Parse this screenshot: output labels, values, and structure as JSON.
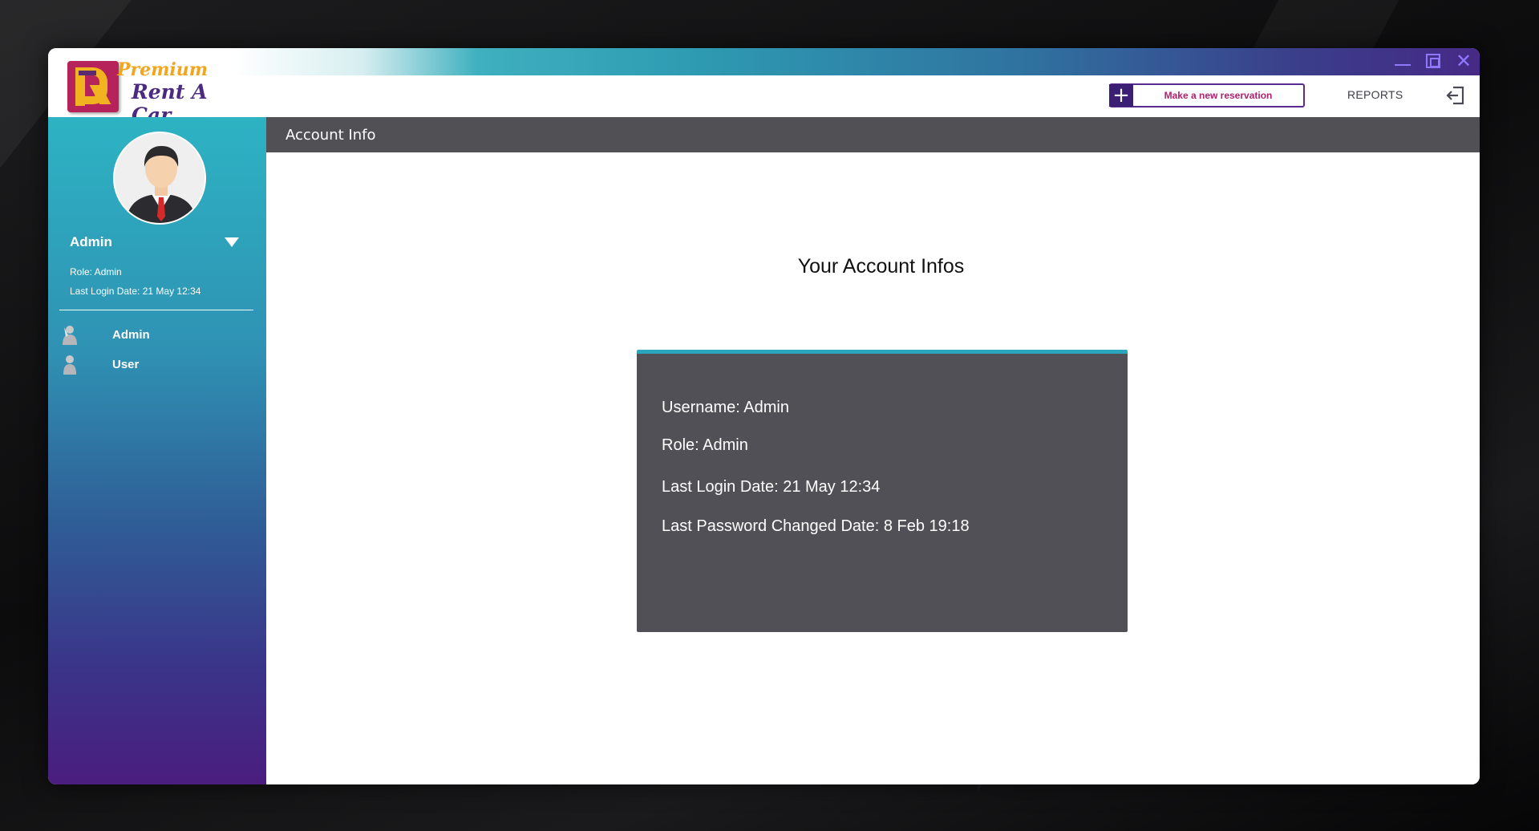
{
  "app": {
    "logo_line1": "Premium",
    "logo_line2": "Rent A Car"
  },
  "header": {
    "reserve_label": "Make a new reservation",
    "reports_label": "REPORTS"
  },
  "sidebar": {
    "user_name": "Admin",
    "role": "Role: Admin",
    "last_login": "Last Login Date: 21 May 12:34",
    "items": [
      {
        "label": "Admin",
        "icon": "admin-user-icon"
      },
      {
        "label": "User",
        "icon": "user-icon"
      }
    ]
  },
  "main": {
    "section_title": "Account Info",
    "heading": "Your Account Infos",
    "card": {
      "username": "Username: Admin",
      "role": "Role: Admin",
      "last_login": "Last Login Date: 21 May 12:34",
      "last_password_change": "Last Password Changed Date: 8 Feb 19:18"
    }
  },
  "colors": {
    "accent_teal": "#2ba7bd",
    "accent_purple": "#4a1d7f",
    "reserve_text": "#b0216d",
    "card_bg": "#515056"
  }
}
